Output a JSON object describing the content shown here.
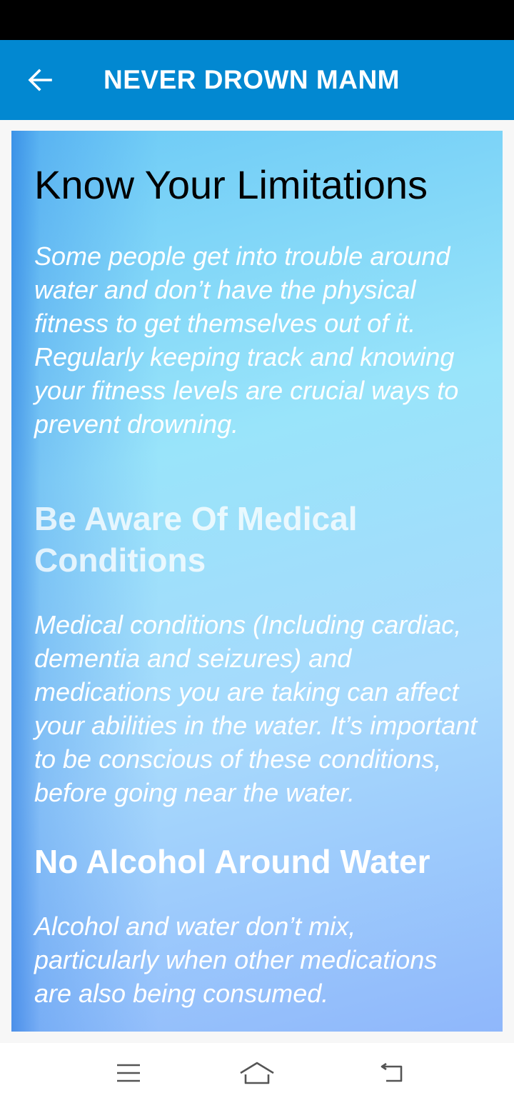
{
  "app_bar": {
    "title": "NEVER DROWN MANM",
    "back_icon": "arrow-left-icon",
    "background": "#0288d1"
  },
  "content": {
    "sections": [
      {
        "heading": "Know Your Limitations",
        "body": "Some people get into trouble around water and don’t have the physical fitness to get themselves out of it. Regularly keeping track and knowing your fitness levels are crucial ways to prevent drowning."
      },
      {
        "heading": "Be Aware Of Medical Conditions",
        "body": "Medical conditions (Including cardiac, dementia and seizures) and medications you are taking can affect your abilities in the water. It’s important to be conscious of these conditions, before going near the water."
      },
      {
        "heading": "No Alcohol Around Water",
        "body": "Alcohol and water don’t mix, particularly when other medications are also being consumed."
      }
    ]
  },
  "nav_bar": {
    "icons": [
      "menu-icon",
      "home-icon",
      "back-icon"
    ]
  }
}
